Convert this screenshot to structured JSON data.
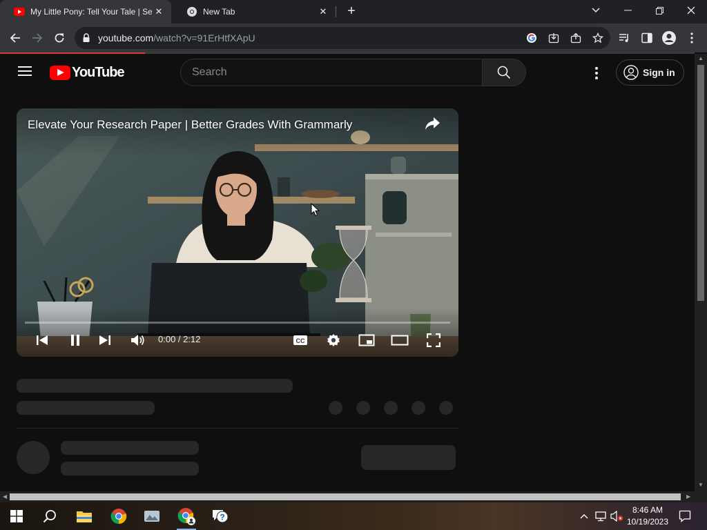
{
  "browser": {
    "tabs": [
      {
        "title": "My Little Pony: Tell Your Tale | Se",
        "favicon": "youtube-icon",
        "active": true
      },
      {
        "title": "New Tab",
        "favicon": "chrome-icon",
        "active": false
      }
    ],
    "new_tab_label": "+",
    "url_host": "youtube.com",
    "url_path": "/watch?v=91ErHtfXApU"
  },
  "youtube": {
    "logo_text": "YouTube",
    "search_placeholder": "Search",
    "sign_in_label": "Sign in"
  },
  "player": {
    "title": "Elevate Your Research Paper | Better Grades With Grammarly",
    "time": "0:00 / 2:12",
    "progress": 0,
    "cc_label": "CC"
  },
  "taskbar": {
    "apps": [
      "start-icon",
      "search-icon",
      "file-explorer-icon",
      "chrome-icon",
      "photos-icon",
      "chrome-profile-icon",
      "help-icon"
    ],
    "time": "8:46 AM",
    "date": "10/19/2023"
  },
  "colors": {
    "youtube_red": "#ff0000",
    "page_bg": "#0f0f0f",
    "chrome_toolbar": "#35363a",
    "tabstrip": "#202124"
  }
}
